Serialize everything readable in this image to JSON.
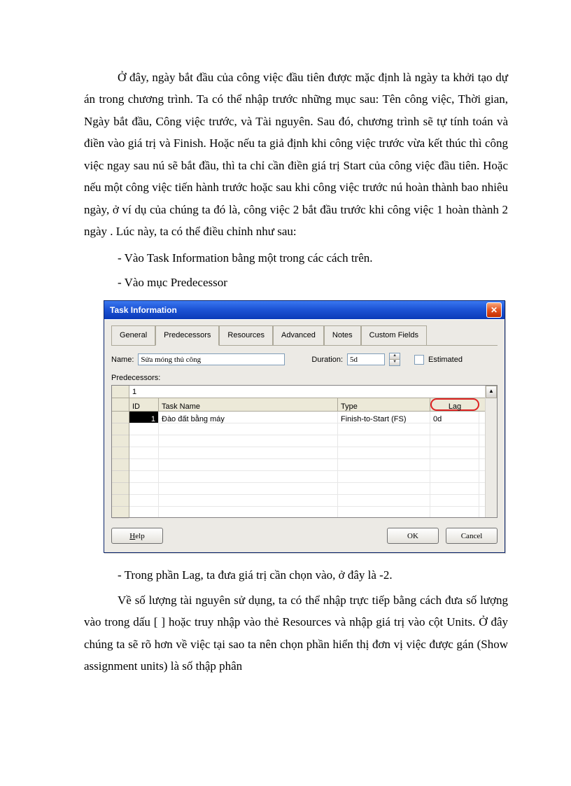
{
  "para1": "Ở đây, ngày bắt đầu của công việc đầu tiên được mặc định là ngày ta khởi tạo dự án trong chương trình. Ta có thể nhập trước những mục sau: Tên công việc, Thời gian, Ngày bắt đầu, Công việc trước, và Tài nguyên. Sau đó, chương trình sẽ tự tính toán và điền vào giá trị và Finish. Hoặc nếu ta giả định khi công việc trước vừa kết thúc thì công việc ngay sau nú sẽ bắt đầu, thì ta chỉ cần điền giá trị Start của công việc đầu tiên. Hoặc nếu một công việc tiến hành trước hoặc sau khi công việc trước nú hoàn thành bao nhiêu ngày, ở ví dụ của chúng ta đó là, công việc 2 bắt đầu trước khi công việc 1 hoàn thành 2 ngày . Lúc này, ta có thể điều chỉnh như sau:",
  "bullet1": "- Vào Task Information bằng một trong các cách trên.",
  "bullet2": "- Vào mục Predecessor",
  "dialog": {
    "title": "Task Information",
    "tabs": [
      "General",
      "Predecessors",
      "Resources",
      "Advanced",
      "Notes",
      "Custom Fields"
    ],
    "name_label": "Name:",
    "name_value": "Sửa móng thủ công",
    "duration_label": "Duration:",
    "duration_value": "5d",
    "estimated_label": "Estimated",
    "pred_label": "Predecessors:",
    "formula_bar": "1",
    "headers": {
      "id": "ID",
      "task_name": "Task Name",
      "type": "Type",
      "lag": "Lag"
    },
    "row": {
      "id": "1",
      "task_name": "Đào đất bằng máy",
      "type": "Finish-to-Start (FS)",
      "lag": "0d"
    },
    "btn_help": "Help",
    "btn_ok": "OK",
    "btn_cancel": "Cancel"
  },
  "bullet3": "- Trong phần Lag, ta đưa giá trị cần chọn vào, ở đây là -2.",
  "para2": "Về số lượng tài nguyên sử dụng, ta có thể nhập trực tiếp bằng cách đưa số lượng vào trong dấu [ ] hoặc truy nhập vào thẻ Resources và nhập giá trị vào cột Units. Ở đây chúng ta sẽ rõ hơn về việc tại sao ta nên chọn phần hiển thị đơn vị việc được gán (Show assignment units) là số thập phân"
}
